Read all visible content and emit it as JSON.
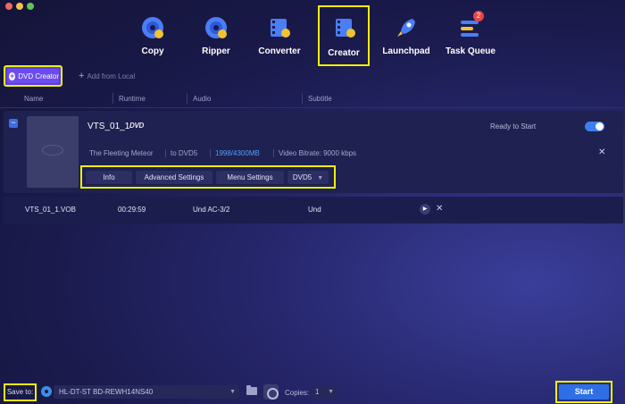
{
  "toolbar": {
    "tabs": [
      {
        "label": "Copy",
        "icon": "copy-disc-icon"
      },
      {
        "label": "Ripper",
        "icon": "ripper-disc-icon"
      },
      {
        "label": "Converter",
        "icon": "converter-film-icon"
      },
      {
        "label": "Creator",
        "icon": "creator-film-icon",
        "active": true
      },
      {
        "label": "Launchpad",
        "icon": "launchpad-rocket-icon"
      },
      {
        "label": "Task Queue",
        "icon": "task-queue-icon",
        "badge": "2"
      }
    ]
  },
  "mode": {
    "label": "DVD Creator"
  },
  "add_local": {
    "label": "Add from Local"
  },
  "columns": {
    "name": "Name",
    "runtime": "Runtime",
    "audio": "Audio",
    "subtitle": "Subtitle"
  },
  "title_item": {
    "name": "VTS_01_1",
    "format_logo": "DVD",
    "status": "Ready to Start",
    "enabled": true,
    "menu_name": "The Fleeting Meteor",
    "target": "to DVD5",
    "size": "1998/4300MB",
    "video_bitrate": "Video Bitrate: 9000 kbps",
    "buttons": {
      "info": "Info",
      "advanced": "Advanced Settings",
      "menu": "Menu Settings",
      "disc_type": "DVD5"
    }
  },
  "track": {
    "file": "VTS_01_1.VOB",
    "runtime": "00:29:59",
    "audio": "Und  AC-3/2",
    "subtitle": "Und"
  },
  "footer": {
    "save_to_label": "Save to:",
    "drive": "HL-DT-ST BD-REWH14NS40",
    "copies_label": "Copies:",
    "copies_value": "1",
    "start_label": "Start"
  },
  "colors": {
    "accent": "#2f6fe6",
    "highlight": "#eef200",
    "mode_button": "#6c4cf0",
    "size_text": "#4da0ff"
  }
}
